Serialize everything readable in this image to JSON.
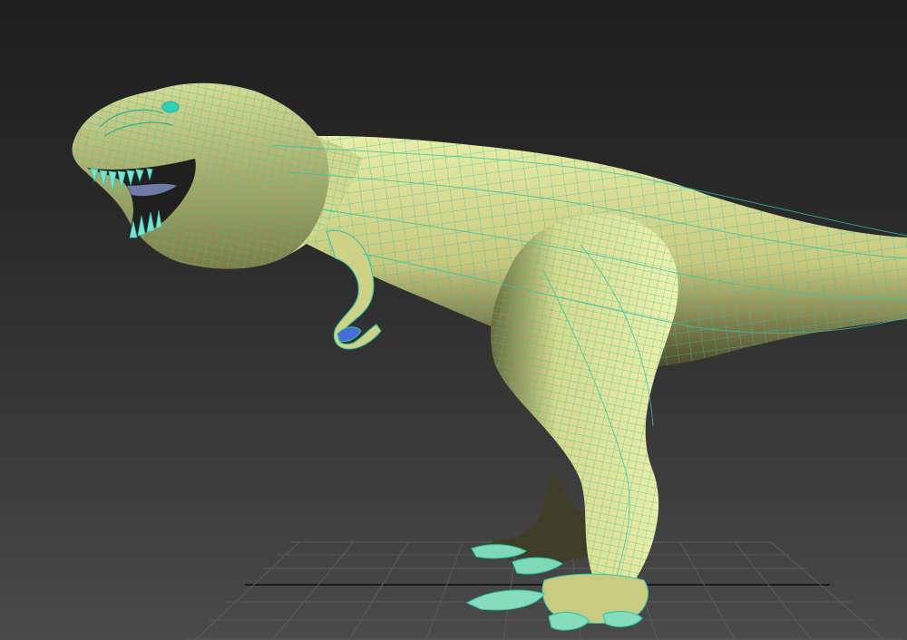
{
  "viewport": {
    "background": "#2b2b2b",
    "grid_color": "#5a5a5a",
    "model": {
      "subject": "t-rex-mesh",
      "shade_color": "#e2e59a",
      "wireframe_color": "#2fc6a8",
      "selected_color": "#7fe0d0"
    }
  }
}
